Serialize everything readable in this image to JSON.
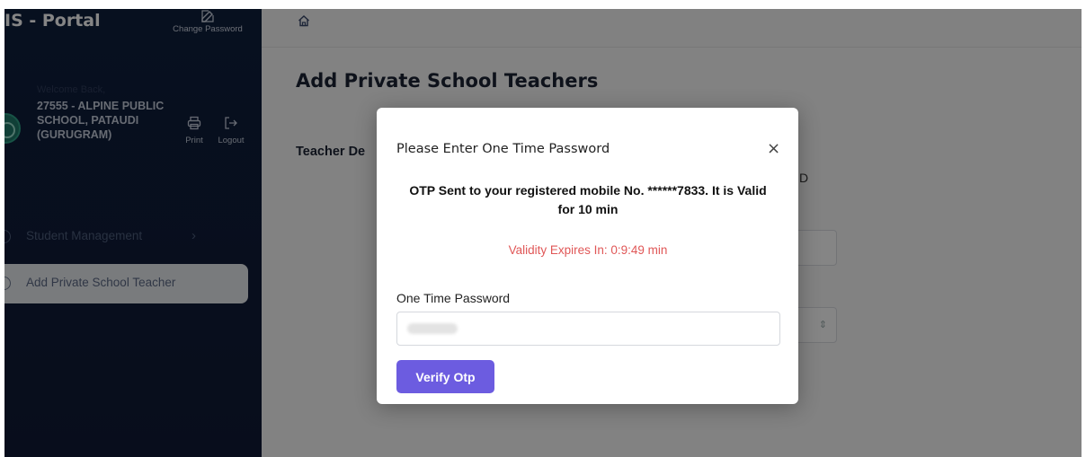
{
  "sidebar": {
    "brand": "IS - Portal",
    "change_password": "Change Password",
    "welcome": "Welcome Back,",
    "school_name": "27555 - ALPINE PUBLIC SCHOOL, PATAUDI (GURUGRAM)",
    "print": "Print",
    "logout": "Logout",
    "menu": [
      {
        "label": "Student Management",
        "icon": "circle-icon",
        "has_submenu": true
      },
      {
        "label": "Add Private School Teacher",
        "icon": "circle-icon",
        "active": true
      }
    ]
  },
  "main": {
    "home_icon": "home-icon",
    "page_title": "Add Private School Teachers",
    "section_label": "Teacher De",
    "column_label_fragment": "D"
  },
  "modal": {
    "title": "Please Enter One Time Password",
    "close": "×",
    "otp_message": "OTP Sent to your registered mobile No. ******7833. It is Valid for 10 min",
    "validity": "Validity Expires In: 0:9:49 min",
    "field_label": "One Time Password",
    "otp_value": "",
    "verify_label": "Verify Otp"
  },
  "colors": {
    "sidebar_bg": "#0f1f3d",
    "primary_button": "#6c5ce0",
    "validity_text": "#e05757"
  }
}
